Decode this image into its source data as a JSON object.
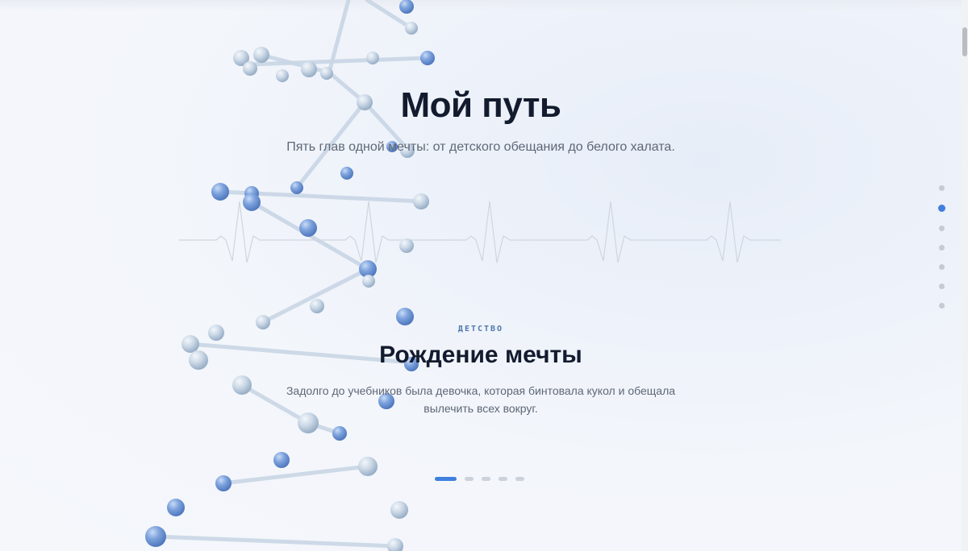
{
  "hero": {
    "title": "Мой путь",
    "subtitle": "Пять глав одной мечты: от детского обещания до белого халата."
  },
  "chapter": {
    "label": "ДЕТСТВО",
    "title": "Рождение мечты",
    "text": "Задолго до учебников была девочка, которая бинтовала кукол и обещала вылечить всех вокруг."
  },
  "slider": {
    "count": 5,
    "active_index": 0
  },
  "side_nav": {
    "count": 7,
    "active_index": 1
  },
  "colors": {
    "accent": "#3f7fde",
    "heading": "#131b2e",
    "body_text": "#5f6776",
    "label": "#4f78ad",
    "ecg_line": "#cfd6df",
    "bead_blue": "#6f97d6",
    "bead_pale": "#c3d1e0"
  },
  "icons": {
    "molecule": "molecule-strand",
    "heartbeat": "ecg-line"
  }
}
